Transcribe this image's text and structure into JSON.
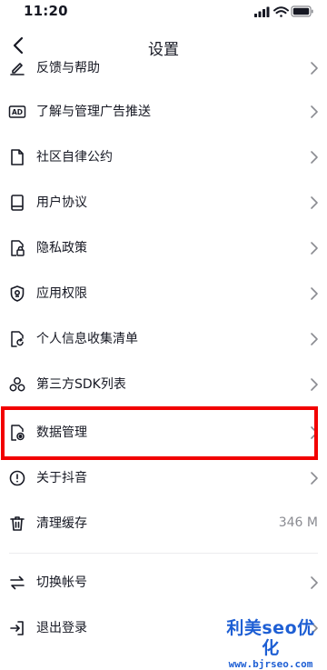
{
  "status_bar": {
    "time": "11:20"
  },
  "nav": {
    "title": "设置"
  },
  "items": [
    {
      "label": "反馈与帮助",
      "icon": "feedback-icon"
    },
    {
      "label": "了解与管理广告推送",
      "icon": "ad-icon"
    },
    {
      "label": "社区自律公约",
      "icon": "document-icon"
    },
    {
      "label": "用户协议",
      "icon": "book-icon"
    },
    {
      "label": "隐私政策",
      "icon": "privacy-lock-icon"
    },
    {
      "label": "应用权限",
      "icon": "shield-icon"
    },
    {
      "label": "个人信息收集清单",
      "icon": "document-refresh-icon"
    },
    {
      "label": "第三方SDK列表",
      "icon": "sdk-icon"
    },
    {
      "label": "数据管理",
      "icon": "data-manage-icon"
    },
    {
      "label": "关于抖音",
      "icon": "info-icon"
    },
    {
      "label": "清理缓存",
      "icon": "trash-icon",
      "value": "346 M"
    },
    {
      "label": "切换帐号",
      "icon": "switch-icon"
    },
    {
      "label": "退出登录",
      "icon": "logout-icon"
    }
  ],
  "watermark": {
    "line1": "利美seo优化",
    "line2": "www.bjrseo.com"
  },
  "colors": {
    "highlight": "#f20000",
    "watermark": "#1e5fd4"
  }
}
